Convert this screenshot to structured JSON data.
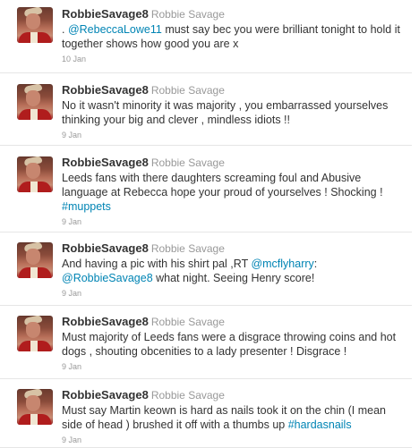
{
  "tweets": [
    {
      "screen_name": "RobbieSavage8",
      "full_name": "Robbie Savage",
      "time": "10 Jan",
      "parts": [
        {
          "t": ". ",
          "k": "text"
        },
        {
          "t": "@RebeccaLowe11",
          "k": "mention"
        },
        {
          "t": " must say bec you were brilliant tonight to hold it together shows how good you are x",
          "k": "text"
        }
      ]
    },
    {
      "screen_name": "RobbieSavage8",
      "full_name": "Robbie Savage",
      "time": "9 Jan",
      "parts": [
        {
          "t": "No it wasn't minority it was majority , you embarrassed yourselves thinking your big and clever , mindless idiots !!",
          "k": "text"
        }
      ]
    },
    {
      "screen_name": "RobbieSavage8",
      "full_name": "Robbie Savage",
      "time": "9 Jan",
      "parts": [
        {
          "t": "Leeds fans with there daughters screaming foul and Abusive language at Rebecca hope your proud of yourselves ! Shocking ! ",
          "k": "text"
        },
        {
          "t": "#muppets",
          "k": "hashtag"
        }
      ]
    },
    {
      "screen_name": "RobbieSavage8",
      "full_name": "Robbie Savage",
      "time": "9 Jan",
      "parts": [
        {
          "t": "And having a pic with his shirt pal ,RT ",
          "k": "text"
        },
        {
          "t": "@mcflyharry",
          "k": "mention"
        },
        {
          "t": ": ",
          "k": "text"
        },
        {
          "t": "@RobbieSavage8",
          "k": "mention"
        },
        {
          "t": " what night. Seeing Henry score!",
          "k": "text"
        }
      ]
    },
    {
      "screen_name": "RobbieSavage8",
      "full_name": "Robbie Savage",
      "time": "9 Jan",
      "parts": [
        {
          "t": "Must majority of Leeds fans were a disgrace throwing coins and hot dogs , shouting obcenities to a lady presenter ! Disgrace !",
          "k": "text"
        }
      ]
    },
    {
      "screen_name": "RobbieSavage8",
      "full_name": "Robbie Savage",
      "time": "9 Jan",
      "parts": [
        {
          "t": "Must say Martin keown is hard as nails took it on the chin (I mean side of head ) brushed it off with a thumbs up ",
          "k": "text"
        },
        {
          "t": "#hardasnails",
          "k": "hashtag"
        }
      ]
    }
  ]
}
